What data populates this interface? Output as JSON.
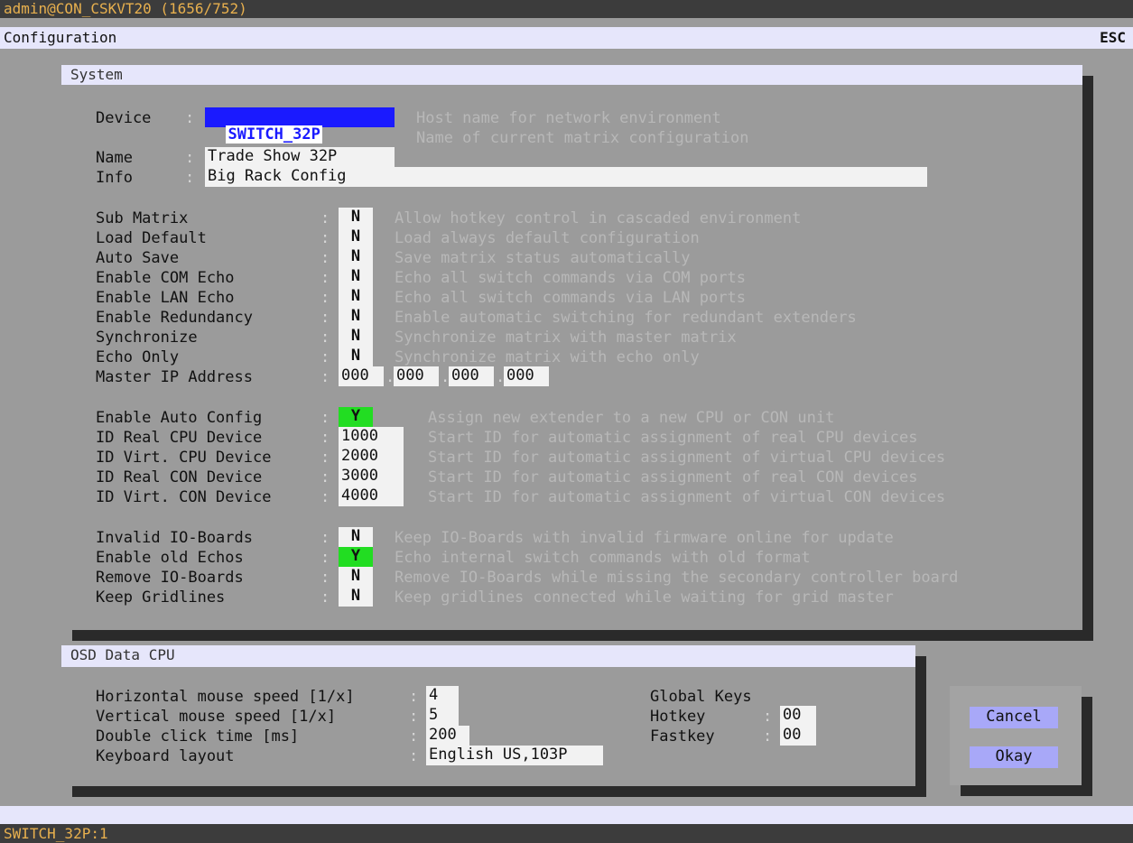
{
  "window": {
    "title": "admin@CON_CSKVT20 (1656/752)",
    "menu": "Configuration",
    "esc": "ESC",
    "status": "SWITCH_32P:1"
  },
  "system": {
    "heading": "System",
    "device": {
      "label": "Device",
      "value": "SWITCH_32P",
      "help": "Host name for network environment"
    },
    "name_help": "Name of current matrix configuration",
    "name": {
      "label": "Name",
      "value": "Trade Show 32P"
    },
    "info": {
      "label": "Info",
      "value": "Big Rack Config"
    },
    "flags": [
      {
        "label": "Sub Matrix",
        "value": "N",
        "help": "Allow hotkey control in cascaded environment"
      },
      {
        "label": "Load Default",
        "value": "N",
        "help": "Load always default configuration"
      },
      {
        "label": "Auto Save",
        "value": "N",
        "help": "Save matrix status automatically"
      },
      {
        "label": "Enable COM Echo",
        "value": "N",
        "help": "Echo all switch commands via COM ports"
      },
      {
        "label": "Enable LAN Echo",
        "value": "N",
        "help": "Echo all switch commands via LAN ports"
      },
      {
        "label": "Enable Redundancy",
        "value": "N",
        "help": "Enable automatic switching for redundant extenders"
      },
      {
        "label": "Synchronize",
        "value": "N",
        "help": "Synchronize matrix with master matrix"
      },
      {
        "label": "Echo Only",
        "value": "N",
        "help": "Synchronize matrix with echo only"
      }
    ],
    "master_ip": {
      "label": "Master IP Address",
      "octets": [
        "000",
        "000",
        "000",
        "000"
      ]
    },
    "auto_config": {
      "label": "Enable Auto Config",
      "value": "Y",
      "help": "Assign new extender to a new CPU or CON unit"
    },
    "ids": [
      {
        "label": "ID Real CPU Device",
        "value": "1000",
        "help": "Start ID for automatic assignment of real CPU devices"
      },
      {
        "label": "ID Virt. CPU Device",
        "value": "2000",
        "help": "Start ID for automatic assignment of virtual CPU devices"
      },
      {
        "label": "ID Real CON Device",
        "value": "3000",
        "help": "Start ID for automatic assignment of real CON devices"
      },
      {
        "label": "ID Virt. CON Device",
        "value": "4000",
        "help": "Start ID for automatic assignment of virtual CON devices"
      }
    ],
    "boards": [
      {
        "label": "Invalid IO-Boards",
        "value": "N",
        "help": "Keep IO-Boards with invalid firmware online for update"
      },
      {
        "label": "Enable old Echos",
        "value": "Y",
        "help": "Echo internal switch commands with old format"
      },
      {
        "label": "Remove IO-Boards",
        "value": "N",
        "help": "Remove IO-Boards while missing the secondary controller board"
      },
      {
        "label": "Keep Gridlines",
        "value": "N",
        "help": "Keep gridlines connected while waiting for grid master"
      }
    ]
  },
  "osd": {
    "heading": "OSD Data CPU",
    "rows": [
      {
        "label": "Horizontal mouse speed [1/x]",
        "value": "4"
      },
      {
        "label": "Vertical mouse speed [1/x]",
        "value": "5"
      },
      {
        "label": "Double click time [ms]",
        "value": "200"
      },
      {
        "label": "Keyboard layout",
        "value": "English US,103P"
      }
    ],
    "global_keys": "Global Keys",
    "hotkey": {
      "label": "Hotkey",
      "value": "00"
    },
    "fastkey": {
      "label": "Fastkey",
      "value": "00"
    }
  },
  "buttons": {
    "cancel": "Cancel",
    "okay": "Okay"
  },
  "colors": {
    "accent_on": "#22dd22",
    "button": "#a8a8f8",
    "header": "#e6e6fb",
    "title_text": "#e8b04e"
  }
}
